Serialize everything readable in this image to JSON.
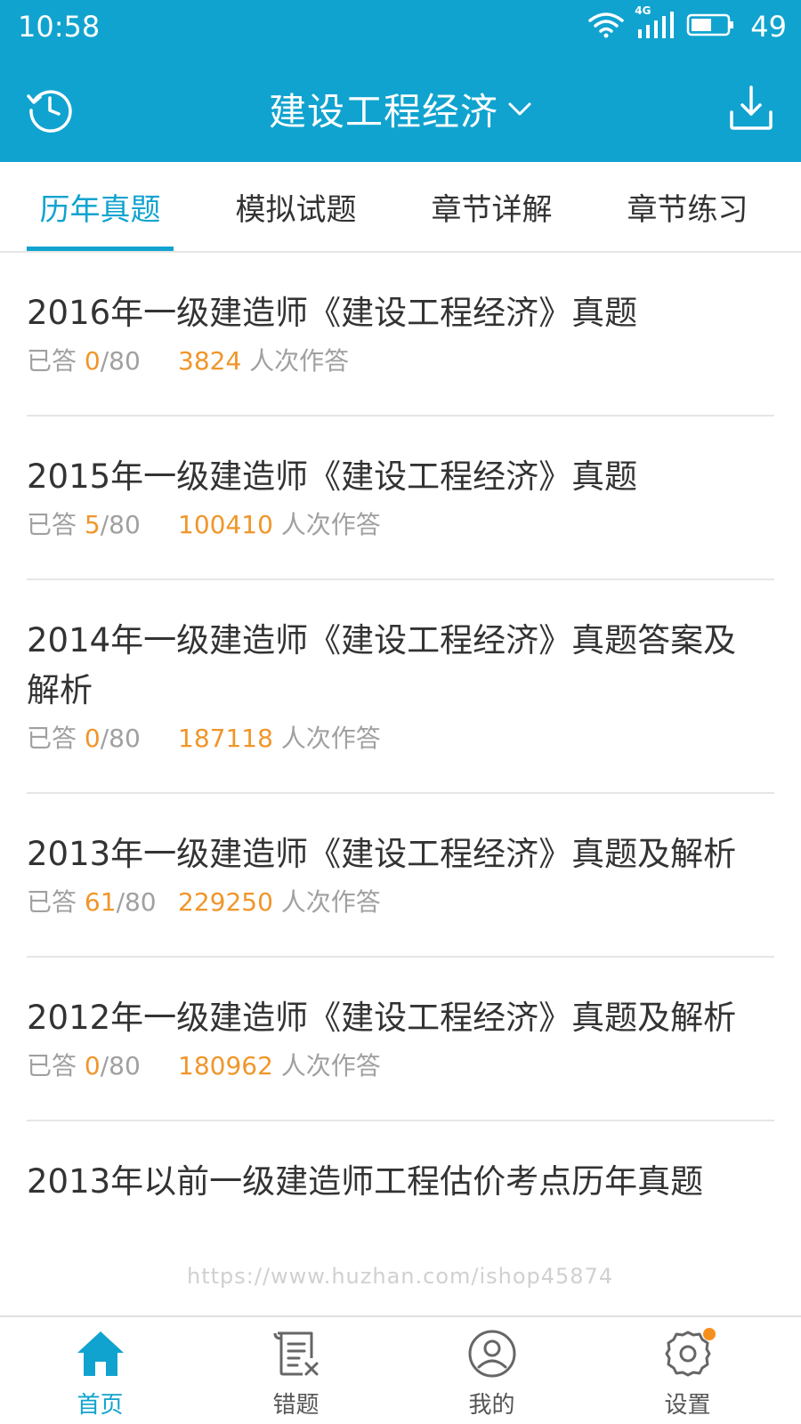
{
  "status_bar": {
    "time": "10:58",
    "network": "4G",
    "battery": "49"
  },
  "header": {
    "title": "建设工程经济",
    "left_icon": "history-icon",
    "right_icon": "download-icon",
    "color": "#11a3cf"
  },
  "tabs": [
    {
      "label": "历年真题",
      "active": true
    },
    {
      "label": "模拟试题",
      "active": false
    },
    {
      "label": "章节详解",
      "active": false
    },
    {
      "label": "章节练习",
      "active": false
    }
  ],
  "list": {
    "answered_label": "已答",
    "attempts_suffix": "人次作答",
    "items": [
      {
        "title": "2016年一级建造师《建设工程经济》真题",
        "answered": "0",
        "total": "/80",
        "attempts": "3824"
      },
      {
        "title": "2015年一级建造师《建设工程经济》真题",
        "answered": "5",
        "total": "/80",
        "attempts": "100410"
      },
      {
        "title": "2014年一级建造师《建设工程经济》真题答案及解析",
        "answered": "0",
        "total": "/80",
        "attempts": "187118"
      },
      {
        "title": "2013年一级建造师《建设工程经济》真题及解析",
        "answered": "61",
        "total": "/80",
        "attempts": "229250"
      },
      {
        "title": "2012年一级建造师《建设工程经济》真题及解析",
        "answered": "0",
        "total": "/80",
        "attempts": "180962"
      },
      {
        "title": "2013年以前一级建造师工程估价考点历年真题"
      }
    ]
  },
  "watermark": "https://www.huzhan.com/ishop45874",
  "bottom_nav": [
    {
      "label": "首页",
      "icon": "home-icon",
      "active": true
    },
    {
      "label": "错题",
      "icon": "wrong-questions-icon",
      "active": false
    },
    {
      "label": "我的",
      "icon": "profile-icon",
      "active": false
    },
    {
      "label": "设置",
      "icon": "settings-icon",
      "active": false,
      "badge": true
    }
  ],
  "colors": {
    "accent": "#11a3cf",
    "highlight": "#f0962a",
    "badge": "#f5901e"
  }
}
